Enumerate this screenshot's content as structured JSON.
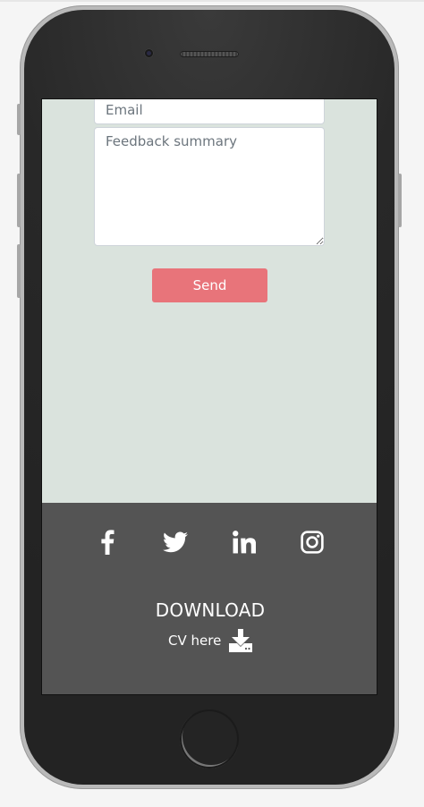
{
  "form": {
    "email_placeholder": "Email",
    "summary_placeholder": "Feedback summary",
    "send_label": "Send"
  },
  "footer": {
    "social": [
      "facebook",
      "twitter",
      "linkedin",
      "instagram"
    ],
    "download_title": "DOWNLOAD",
    "download_sub": "CV here"
  },
  "colors": {
    "screen_bg": "#dae3dd",
    "footer_bg": "#545454",
    "send_button": "#e8747a",
    "phone_body": "#282828"
  }
}
